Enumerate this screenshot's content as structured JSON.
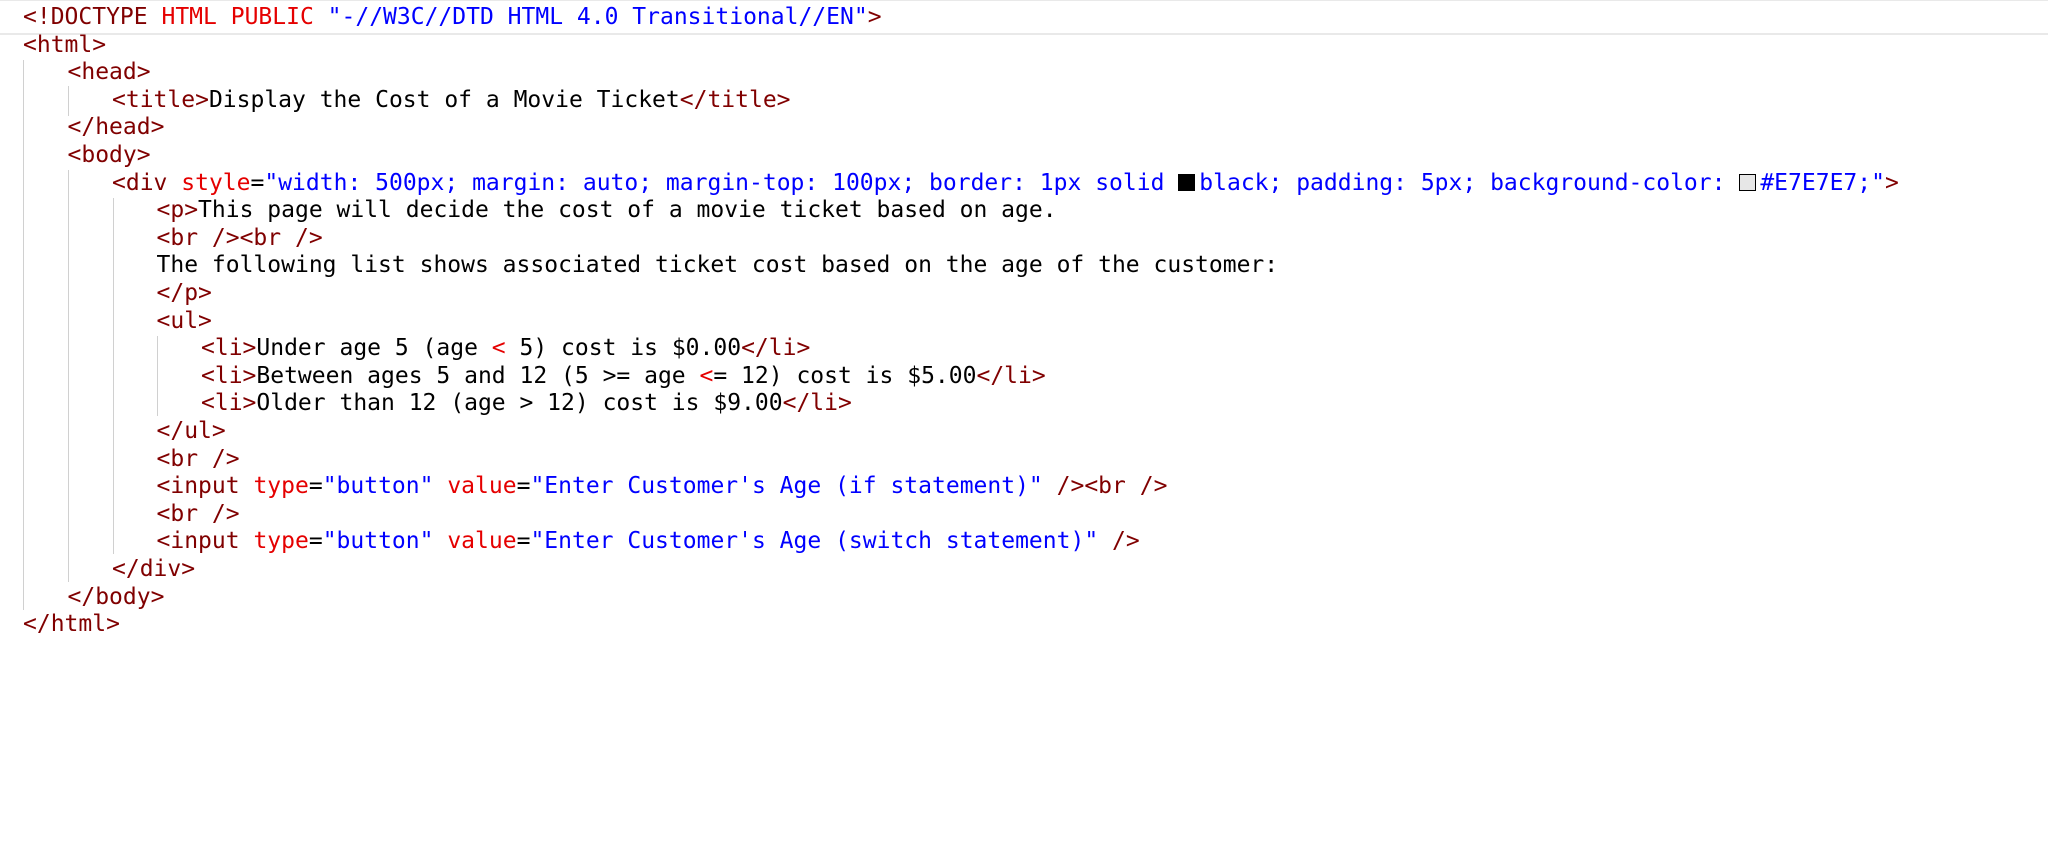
{
  "editor": {
    "lines": [
      [
        {
          "k": "t",
          "s": "<!DOCTYPE "
        },
        {
          "k": "a",
          "s": "HTML PUBLIC "
        },
        {
          "k": "v",
          "s": "\"-//W3C//DTD HTML 4.0 Transitional//EN\""
        },
        {
          "k": "t",
          "s": ">"
        }
      ],
      [
        {
          "k": "t",
          "s": "<html>"
        }
      ],
      [
        {
          "k": "t",
          "s": "<head>"
        }
      ],
      [
        {
          "k": "t",
          "s": "<title>"
        },
        {
          "k": "x",
          "s": "Display the Cost of a Movie Ticket"
        },
        {
          "k": "t",
          "s": "</title>"
        }
      ],
      [
        {
          "k": "t",
          "s": "</head>"
        }
      ],
      [
        {
          "k": "t",
          "s": "<body>"
        }
      ],
      [
        {
          "k": "t",
          "s": "<div "
        },
        {
          "k": "a",
          "s": "style"
        },
        {
          "k": "x",
          "s": "="
        },
        {
          "k": "v",
          "s": "\"width: 500px; margin: auto; margin-top: 100px; border: 1px solid "
        },
        {
          "k": "sw",
          "s": "dark"
        },
        {
          "k": "v",
          "s": "black; padding: 5px; background-color: "
        },
        {
          "k": "sw",
          "s": "light"
        },
        {
          "k": "v",
          "s": "#E7E7E7;\""
        },
        {
          "k": "t",
          "s": ">"
        }
      ],
      [
        {
          "k": "t",
          "s": "<p>"
        },
        {
          "k": "x",
          "s": "This page will decide the cost of a movie ticket based on age."
        }
      ],
      [
        {
          "k": "t",
          "s": "<br /><br />"
        }
      ],
      [
        {
          "k": "x",
          "s": "The following list shows associated ticket cost based on the age of the customer:"
        }
      ],
      [
        {
          "k": "t",
          "s": "</p>"
        }
      ],
      [
        {
          "k": "t",
          "s": "<ul>"
        }
      ],
      [
        {
          "k": "t",
          "s": "<li>"
        },
        {
          "k": "x",
          "s": "Under age 5 (age "
        },
        {
          "k": "e",
          "s": "<"
        },
        {
          "k": "x",
          "s": " 5) cost is $0.00"
        },
        {
          "k": "t",
          "s": "</li>"
        }
      ],
      [
        {
          "k": "t",
          "s": "<li>"
        },
        {
          "k": "x",
          "s": "Between ages 5 and 12 (5 >= age "
        },
        {
          "k": "e",
          "s": "<"
        },
        {
          "k": "x",
          "s": "= 12) cost is $5.00"
        },
        {
          "k": "t",
          "s": "</li>"
        }
      ],
      [
        {
          "k": "t",
          "s": "<li>"
        },
        {
          "k": "x",
          "s": "Older than 12 (age > 12) cost is $9.00"
        },
        {
          "k": "t",
          "s": "</li>"
        }
      ],
      [
        {
          "k": "t",
          "s": "</ul>"
        }
      ],
      [
        {
          "k": "t",
          "s": "<br />"
        }
      ],
      [
        {
          "k": "t",
          "s": "<input "
        },
        {
          "k": "a",
          "s": "type"
        },
        {
          "k": "x",
          "s": "="
        },
        {
          "k": "v",
          "s": "\"button\""
        },
        {
          "k": "x",
          "s": " "
        },
        {
          "k": "a",
          "s": "value"
        },
        {
          "k": "x",
          "s": "="
        },
        {
          "k": "v",
          "s": "\"Enter Customer's Age (if statement)\""
        },
        {
          "k": "t",
          "s": " /><br />"
        }
      ],
      [
        {
          "k": "t",
          "s": "<br />"
        }
      ],
      [
        {
          "k": "t",
          "s": "<input "
        },
        {
          "k": "a",
          "s": "type"
        },
        {
          "k": "x",
          "s": "="
        },
        {
          "k": "v",
          "s": "\"button\""
        },
        {
          "k": "x",
          "s": " "
        },
        {
          "k": "a",
          "s": "value"
        },
        {
          "k": "x",
          "s": "="
        },
        {
          "k": "v",
          "s": "\"Enter Customer's Age (switch statement)\""
        },
        {
          "k": "t",
          "s": " />"
        }
      ],
      [
        {
          "k": "t",
          "s": "</div>"
        }
      ],
      [
        {
          "k": "t",
          "s": "</body>"
        }
      ],
      [
        {
          "k": "t",
          "s": "</html>"
        }
      ]
    ]
  },
  "colors": {
    "tag": "#800000",
    "attribute": "#e50000",
    "value": "#0000ff",
    "text": "#000000",
    "swatch_black": "#000000",
    "swatch_light": "#E7E7E7"
  }
}
